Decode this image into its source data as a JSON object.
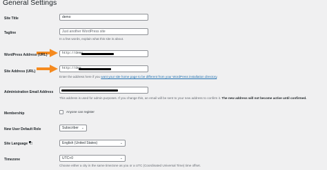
{
  "page": {
    "title": "General Settings"
  },
  "colors": {
    "accent_arrow": "#f58a1f",
    "link": "#2271b1",
    "redaction": "#000000"
  },
  "fields": {
    "site_title": {
      "label": "Site Title",
      "value": "demo"
    },
    "tagline": {
      "label": "Tagline",
      "placeholder": "Just another WordPress site",
      "description": "In a few words, explain what this site is about."
    },
    "wp_address": {
      "label": "WordPress Address (URL)",
      "value": "http://demo."
    },
    "site_address": {
      "label": "Site Address (URL)",
      "value": "http://dem",
      "description_pre": "Enter the address here if you ",
      "description_link": "want your site home page to be different from your WordPress installation directory",
      "description_post": "."
    },
    "admin_email": {
      "label": "Administration Email Address",
      "description_pre": "This address is used for admin purposes. If you change this, an email will be sent to your new address to confirm it. ",
      "description_bold": "The new address will not become active until confirmed."
    },
    "membership": {
      "label": "Membership",
      "checkbox_label": "Anyone can register",
      "checked": false
    },
    "default_role": {
      "label": "New User Default Role",
      "selected": "Subscriber"
    },
    "site_language": {
      "label": "Site Language",
      "selected": "English (United States)",
      "icon": "translate-icon"
    },
    "timezone": {
      "label": "Timezone",
      "selected": "UTC+0",
      "description": "Choose either a city in the same timezone as you or a UTC (Coordinated Universal Time) time offset."
    }
  }
}
